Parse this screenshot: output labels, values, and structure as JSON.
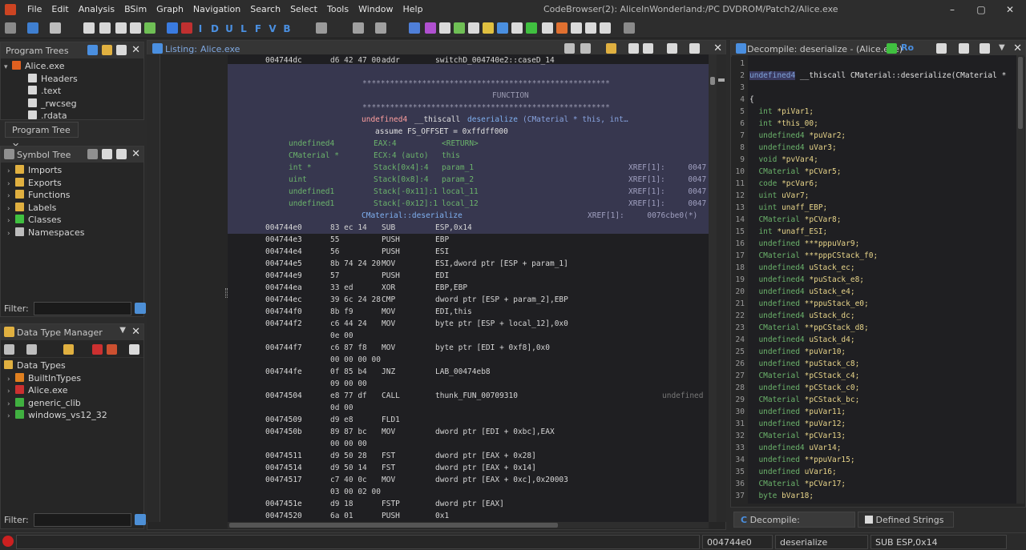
{
  "menu": [
    "File",
    "Edit",
    "Analysis",
    "BSim",
    "Graph",
    "Navigation",
    "Search",
    "Select",
    "Tools",
    "Window",
    "Help"
  ],
  "window_title": "CodeBrowser(2): AliceInWonderland:/PC DVDROM/Patch2/Alice.exe",
  "window_controls": {
    "minimize": "–",
    "maximize": "▢",
    "close": "✕"
  },
  "toolbar_letters": [
    "I",
    "D",
    "U",
    "L",
    "F",
    "V",
    "B"
  ],
  "program_trees": {
    "title": "Program Trees",
    "root": "Alice.exe",
    "items": [
      "Headers",
      ".text",
      "_rwcseg",
      ".rdata"
    ],
    "tab": "Program Tree"
  },
  "symbol_tree": {
    "title": "Symbol Tree",
    "items": [
      "Imports",
      "Exports",
      "Functions",
      "Labels",
      "Classes",
      "Namespaces"
    ],
    "filter_label": "Filter:"
  },
  "data_type_manager": {
    "title": "Data Type Manager",
    "root": "Data Types",
    "items": [
      "BuiltInTypes",
      "Alice.exe",
      "generic_clib",
      "windows_vs12_32"
    ],
    "filter_label": "Filter:"
  },
  "listing": {
    "title": "Listing:",
    "file": "Alice.exe",
    "top_row": {
      "addr": "004744dc",
      "bytes": "d6 42 47 00",
      "mn": "addr",
      "op": "switchD_004740e2::caseD_14"
    },
    "stars1": "******************************************************",
    "function_label": "FUNCTION",
    "stars2": "******************************************************",
    "signature": {
      "ret": "undefined4",
      "conv": "__thiscall",
      "name": "deserialize",
      "params": "(CMaterial * this, int…"
    },
    "assume": "assume FS_OFFSET = 0xffdff000",
    "vars": [
      {
        "type": "undefined4",
        "loc": "EAX:4",
        "name": "<RETURN>",
        "xref": ""
      },
      {
        "type": "CMaterial *",
        "loc": "ECX:4 (auto)",
        "name": "this",
        "xref": ""
      },
      {
        "type": "int *",
        "loc": "Stack[0x4]:4",
        "name": "param_1",
        "xref": "XREF[1]:     0047"
      },
      {
        "type": "uint",
        "loc": "Stack[0x8]:4",
        "name": "param_2",
        "xref": "XREF[1]:     0047"
      },
      {
        "type": "undefined1",
        "loc": "Stack[-0x11]:1",
        "name": "local_11",
        "xref": "XREF[1]:     0047"
      },
      {
        "type": "undefined1",
        "loc": "Stack[-0x12]:1",
        "name": "local_12",
        "xref": "XREF[1]:     0047"
      }
    ],
    "label_row": {
      "label": "CMaterial::deserialize",
      "xref": "XREF[1]:     0076cbe0(*)"
    },
    "rows": [
      {
        "addr": "004744e0",
        "bytes": "83 ec 14",
        "mn": "SUB",
        "op": "ESP,0x14"
      },
      {
        "addr": "004744e3",
        "bytes": "55",
        "mn": "PUSH",
        "op": "EBP"
      },
      {
        "addr": "004744e4",
        "bytes": "56",
        "mn": "PUSH",
        "op": "ESI"
      },
      {
        "addr": "004744e5",
        "bytes": "8b 74 24 20",
        "mn": "MOV",
        "op": "ESI,dword ptr [ESP + param_1]"
      },
      {
        "addr": "004744e9",
        "bytes": "57",
        "mn": "PUSH",
        "op": "EDI"
      },
      {
        "addr": "004744ea",
        "bytes": "33 ed",
        "mn": "XOR",
        "op": "EBP,EBP"
      },
      {
        "addr": "004744ec",
        "bytes": "39 6c 24 28",
        "mn": "CMP",
        "op": "dword ptr [ESP + param_2],EBP"
      },
      {
        "addr": "004744f0",
        "bytes": "8b f9",
        "mn": "MOV",
        "op": "EDI,this"
      },
      {
        "addr": "004744f2",
        "bytes": "c6 44 24",
        "mn": "MOV",
        "op": "byte ptr [ESP + local_12],0x0"
      },
      {
        "addr": "",
        "bytes": "0e 00",
        "mn": "",
        "op": ""
      },
      {
        "addr": "004744f7",
        "bytes": "c6 87 f8",
        "mn": "MOV",
        "op": "byte ptr [EDI + 0xf8],0x0"
      },
      {
        "addr": "",
        "bytes": "00 00 00 00",
        "mn": "",
        "op": ""
      },
      {
        "addr": "004744fe",
        "bytes": "0f 85 b4",
        "mn": "JNZ",
        "op": "LAB_00474eb8"
      },
      {
        "addr": "",
        "bytes": "09 00 00",
        "mn": "",
        "op": ""
      },
      {
        "addr": "00474504",
        "bytes": "e8 77 df",
        "mn": "CALL",
        "op": "thunk_FUN_00709310",
        "note": "undefined"
      },
      {
        "addr": "",
        "bytes": "0d 00",
        "mn": "",
        "op": ""
      },
      {
        "addr": "00474509",
        "bytes": "d9 e8",
        "mn": "FLD1",
        "op": ""
      },
      {
        "addr": "0047450b",
        "bytes": "89 87 bc",
        "mn": "MOV",
        "op": "dword ptr [EDI + 0xbc],EAX"
      },
      {
        "addr": "",
        "bytes": "00 00 00",
        "mn": "",
        "op": ""
      },
      {
        "addr": "00474511",
        "bytes": "d9 50 28",
        "mn": "FST",
        "op": "dword ptr [EAX + 0x28]"
      },
      {
        "addr": "00474514",
        "bytes": "d9 50 14",
        "mn": "FST",
        "op": "dword ptr [EAX + 0x14]"
      },
      {
        "addr": "00474517",
        "bytes": "c7 40 0c",
        "mn": "MOV",
        "op": "dword ptr [EAX + 0xc],0x20003"
      },
      {
        "addr": "",
        "bytes": "03 00 02 00",
        "mn": "",
        "op": ""
      },
      {
        "addr": "0047451e",
        "bytes": "d9 18",
        "mn": "FSTP",
        "op": "dword ptr [EAX]"
      },
      {
        "addr": "00474520",
        "bytes": "6a 01",
        "mn": "PUSH",
        "op": "0x1"
      }
    ]
  },
  "decompile": {
    "title": "Decompile: deserialize -  (Alice.exe)",
    "title_btn": "Ro",
    "lines": [
      {
        "n": "1",
        "t": "",
        "v": ""
      },
      {
        "n": "2",
        "t": "undefined4",
        "v": " __thiscall CMaterial::deserialize(CMaterial *"
      },
      {
        "n": "3",
        "t": "",
        "v": ""
      },
      {
        "n": "4",
        "t": "",
        "v": "{"
      },
      {
        "n": "5",
        "t": "int",
        "v": " *piVar1;"
      },
      {
        "n": "6",
        "t": "int",
        "v": " *this_00;"
      },
      {
        "n": "7",
        "t": "undefined4",
        "v": " *puVar2;"
      },
      {
        "n": "8",
        "t": "undefined4",
        "v": " uVar3;"
      },
      {
        "n": "9",
        "t": "void",
        "v": " *pvVar4;"
      },
      {
        "n": "10",
        "t": "CMaterial",
        "v": " *pCVar5;"
      },
      {
        "n": "11",
        "t": "code",
        "v": " *pcVar6;"
      },
      {
        "n": "12",
        "t": "uint",
        "v": " uVar7;"
      },
      {
        "n": "13",
        "t": "uint",
        "v": " unaff_EBP;"
      },
      {
        "n": "14",
        "t": "CMaterial",
        "v": " *pCVar8;"
      },
      {
        "n": "15",
        "t": "int",
        "v": " *unaff_ESI;"
      },
      {
        "n": "16",
        "t": "undefined",
        "v": " ***pppuVar9;"
      },
      {
        "n": "17",
        "t": "CMaterial",
        "v": " ***pppCStack_f0;"
      },
      {
        "n": "18",
        "t": "undefined4",
        "v": " uStack_ec;"
      },
      {
        "n": "19",
        "t": "undefined4",
        "v": " *puStack_e8;"
      },
      {
        "n": "20",
        "t": "undefined4",
        "v": " uStack_e4;"
      },
      {
        "n": "21",
        "t": "undefined",
        "v": " **ppuStack_e0;"
      },
      {
        "n": "22",
        "t": "undefined4",
        "v": " uStack_dc;"
      },
      {
        "n": "23",
        "t": "CMaterial",
        "v": " **ppCStack_d8;"
      },
      {
        "n": "24",
        "t": "undefined4",
        "v": " uStack_d4;"
      },
      {
        "n": "25",
        "t": "undefined",
        "v": " *puVar10;"
      },
      {
        "n": "26",
        "t": "undefined",
        "v": " *puStack_c8;"
      },
      {
        "n": "27",
        "t": "CMaterial",
        "v": " *pCStack_c4;"
      },
      {
        "n": "28",
        "t": "undefined",
        "v": " *pCStack_c0;"
      },
      {
        "n": "29",
        "t": "CMaterial",
        "v": " *pCStack_bc;"
      },
      {
        "n": "30",
        "t": "undefined",
        "v": " *puVar11;"
      },
      {
        "n": "31",
        "t": "undefined",
        "v": " *puVar12;"
      },
      {
        "n": "32",
        "t": "CMaterial",
        "v": " *pCVar13;"
      },
      {
        "n": "33",
        "t": "undefined4",
        "v": " uVar14;"
      },
      {
        "n": "34",
        "t": "undefined",
        "v": " **ppuVar15;"
      },
      {
        "n": "35",
        "t": "undefined",
        "v": " uVar16;"
      },
      {
        "n": "36",
        "t": "CMaterial",
        "v": " *pCVar17;"
      },
      {
        "n": "37",
        "t": "byte",
        "v": " bVar18;"
      }
    ],
    "tabs": [
      "Decompile: deserialize",
      "Defined Strings"
    ]
  },
  "status": {
    "address": "004744e0",
    "function": "deserialize",
    "instruction": "SUB ESP,0x14"
  },
  "colors": {
    "accent": "#4a8fe0",
    "func_header_bg": "#37374f",
    "type_green": "#6bb36b",
    "var_yellow": "#e8d58a"
  }
}
